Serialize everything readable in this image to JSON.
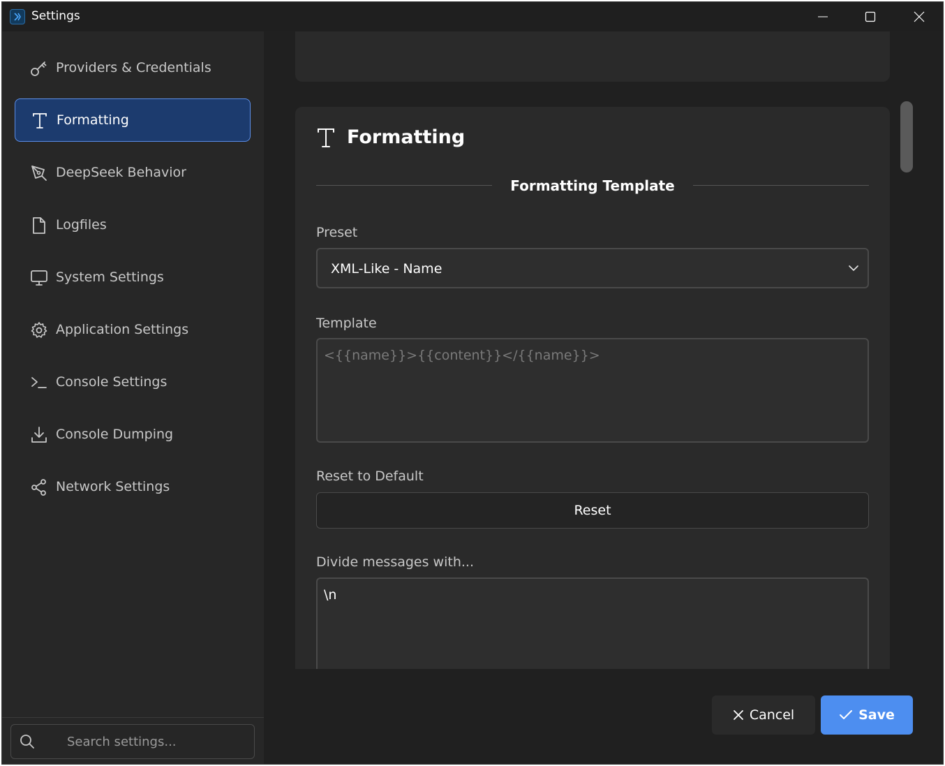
{
  "window": {
    "title": "Settings"
  },
  "sidebar": {
    "items": [
      {
        "label": "Providers & Credentials",
        "icon": "key-icon",
        "active": false
      },
      {
        "label": "Formatting",
        "icon": "text-format-icon",
        "active": true
      },
      {
        "label": "DeepSeek Behavior",
        "icon": "pen-tool-icon",
        "active": false
      },
      {
        "label": "Logfiles",
        "icon": "file-icon",
        "active": false
      },
      {
        "label": "System Settings",
        "icon": "monitor-icon",
        "active": false
      },
      {
        "label": "Application Settings",
        "icon": "gear-icon",
        "active": false
      },
      {
        "label": "Console Settings",
        "icon": "terminal-icon",
        "active": false
      },
      {
        "label": "Console Dumping",
        "icon": "download-icon",
        "active": false
      },
      {
        "label": "Network Settings",
        "icon": "share-icon",
        "active": false
      }
    ],
    "search": {
      "placeholder": "Search settings..."
    }
  },
  "card": {
    "title": "Formatting",
    "section_title": "Formatting Template",
    "preset": {
      "label": "Preset",
      "value": "XML-Like - Name"
    },
    "template": {
      "label": "Template",
      "placeholder": "<{{name}}>{{content}}</{{name}}>"
    },
    "reset": {
      "label": "Reset to Default",
      "button": "Reset"
    },
    "divider": {
      "label": "Divide messages with...",
      "value": "\\n"
    }
  },
  "footer": {
    "cancel": "Cancel",
    "save": "Save"
  },
  "colors": {
    "accent": "#4d8ef0",
    "active_nav_bg": "#1c3b6e",
    "active_nav_border": "#5b8ee8",
    "window_bg": "#202020",
    "sidebar_bg": "#272727",
    "card_bg": "#2a2a2a"
  }
}
